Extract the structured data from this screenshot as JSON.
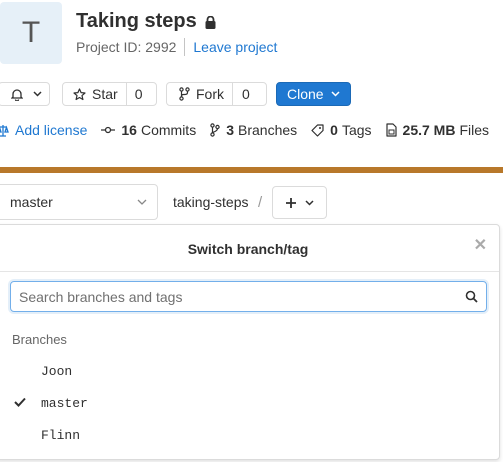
{
  "project": {
    "avatar_letter": "T",
    "title": "Taking steps",
    "id_label": "Project ID: 2992",
    "leave_label": "Leave project"
  },
  "actions": {
    "star_label": "Star",
    "star_count": "0",
    "fork_label": "Fork",
    "fork_count": "0",
    "clone_label": "Clone"
  },
  "stats": {
    "license_label": "Add license",
    "commits_count": "16",
    "commits_label": "Commits",
    "branches_count": "3",
    "branches_label": "Branches",
    "tags_count": "0",
    "tags_label": "Tags",
    "size_value": "25.7 MB",
    "size_label": "Files"
  },
  "repo": {
    "current_branch": "master",
    "path_root": "taking-steps",
    "path_sep": "/"
  },
  "dropdown": {
    "title": "Switch branch/tag",
    "search_placeholder": "Search branches and tags",
    "section_label": "Branches",
    "branches": [
      "Joon",
      "master",
      "Flinn"
    ],
    "selected_branch": "master"
  },
  "colors": {
    "accent": "#1f78d1",
    "banner": "#b8782a"
  }
}
